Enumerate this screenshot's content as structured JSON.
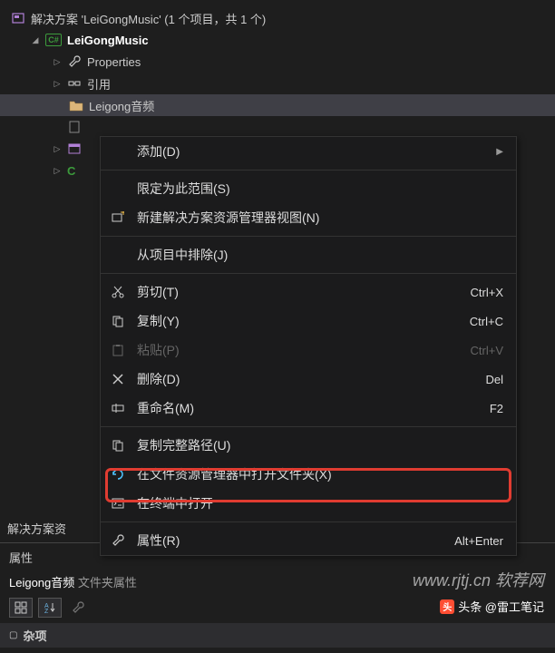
{
  "tree": {
    "solution": "解决方案 'LeiGongMusic' (1 个项目，共 1 个)",
    "project": "LeiGongMusic",
    "cs_badge": "C#",
    "properties": "Properties",
    "references": "引用",
    "folder": "Leigong音频",
    "cfile": "C"
  },
  "menu": {
    "add": "添加(D)",
    "scope": "限定为此范围(S)",
    "newview": "新建解决方案资源管理器视图(N)",
    "exclude": "从项目中排除(J)",
    "cut": "剪切(T)",
    "cut_sc": "Ctrl+X",
    "copy": "复制(Y)",
    "copy_sc": "Ctrl+C",
    "paste": "粘贴(P)",
    "paste_sc": "Ctrl+V",
    "delete": "删除(D)",
    "delete_sc": "Del",
    "rename": "重命名(M)",
    "rename_sc": "F2",
    "copypath": "复制完整路径(U)",
    "openfolder": "在文件资源管理器中打开文件夹(X)",
    "terminal": "在终端中打开",
    "props": "属性(R)",
    "props_sc": "Alt+Enter"
  },
  "bottom_label": "解决方案资",
  "props": {
    "title": "属性",
    "name": "Leigong音频",
    "type": "文件夹属性",
    "misc": "杂项"
  },
  "watermark": "www.rjtj.cn 软荐网",
  "byline": "头条 @雷工笔记"
}
